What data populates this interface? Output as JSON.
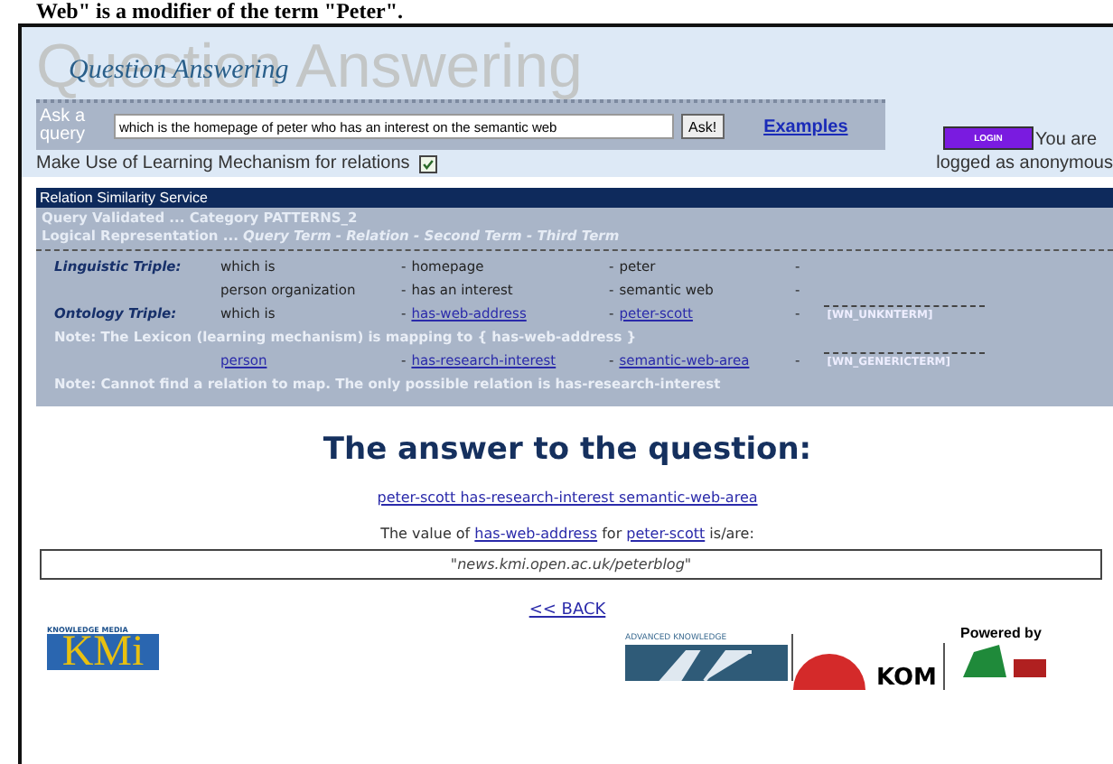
{
  "document_caption": "Web\" is a modifier of the term \"Peter\".",
  "header": {
    "title_large": "Question Answering",
    "title_small": "Question Answering"
  },
  "query": {
    "label_1": "Ask a",
    "label_2": "query",
    "value": "which is the homepage of peter who has an interest on the semantic web",
    "button": "Ask!",
    "examples_link": "Examples"
  },
  "login": {
    "button": "LOGIN",
    "status_1": "You are",
    "status_2": "logged as anonymous"
  },
  "learning_option": {
    "label": "Make Use of Learning Mechanism for relations",
    "checked": true
  },
  "relation_service": {
    "title": "Relation Similarity Service",
    "validated": "Query Validated ... Category PATTERNS_2",
    "logical_prefix": "Logical Representation ...",
    "logical_terms": "Query Term - Relation - Second Term - Third Term",
    "rows": [
      {
        "kind": "triple",
        "label": "Linguistic Triple:",
        "cells": [
          {
            "text": "which is",
            "link": false
          },
          {
            "prefix": "-",
            "text": "homepage",
            "link": false
          },
          {
            "prefix": "-",
            "text": "peter",
            "link": false
          },
          {
            "prefix": "-"
          }
        ]
      },
      {
        "kind": "triple",
        "cells": [
          {
            "text": "person organization",
            "link": false
          },
          {
            "prefix": "-",
            "text": "has an interest",
            "link": false
          },
          {
            "prefix": "-",
            "text": "semantic web",
            "link": false
          },
          {
            "prefix": "-"
          }
        ]
      },
      {
        "kind": "triple",
        "label": "Ontology Triple:",
        "cells": [
          {
            "text": "which is",
            "link": false
          },
          {
            "prefix": "-",
            "text": "has-web-address",
            "link": true
          },
          {
            "prefix": "-",
            "text": "peter-scott",
            "link": true
          },
          {
            "prefix": "-",
            "tag": "[WN_UNKNTERM]"
          }
        ]
      },
      {
        "kind": "note",
        "text": "Note: The Lexicon (learning mechanism) is mapping to { has-web-address }"
      },
      {
        "kind": "triple",
        "cells": [
          {
            "text": "person",
            "link": true
          },
          {
            "prefix": "-",
            "text": "has-research-interest",
            "link": true
          },
          {
            "prefix": "-",
            "text": "semantic-web-area",
            "link": true
          },
          {
            "prefix": "-",
            "tag": "[WN_GENERICTERM]"
          }
        ]
      },
      {
        "kind": "note",
        "text": "Note: Cannot find a relation to map. The only possible relation is has-research-interest"
      }
    ]
  },
  "answer": {
    "heading": "The answer to the question:",
    "answer_link": "peter-scott has-research-interest semantic-web-area",
    "value_sentence": [
      {
        "text": "The value of",
        "link": false
      },
      {
        "text": "has-web-address",
        "link": true
      },
      {
        "text": "for",
        "link": false
      },
      {
        "text": "peter-scott",
        "link": true
      },
      {
        "text": "is/are:",
        "link": false
      }
    ],
    "value": "\"news.kmi.open.ac.uk/peterblog\"",
    "back_link": "<< BACK"
  },
  "footer": {
    "kmi_caption": "KNOWLEDGE MEDIA",
    "kmi_logo": "KMi",
    "akt_caption": "ADVANCED KNOWLEDGE",
    "kom_logo": "KOM",
    "powered_by": "Powered by"
  }
}
